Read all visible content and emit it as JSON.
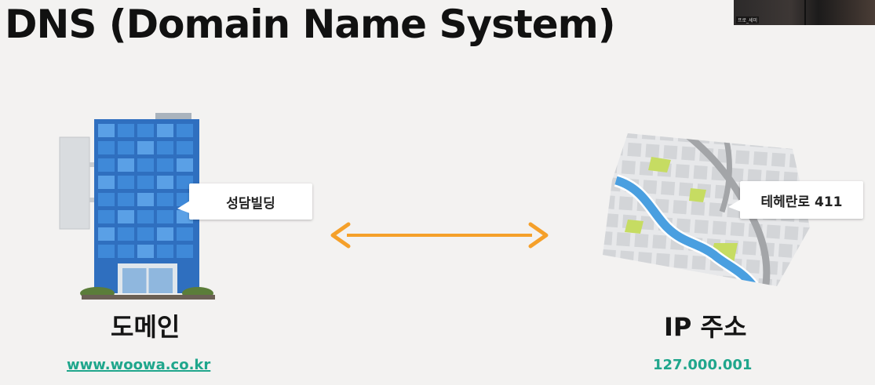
{
  "slide": {
    "title": "DNS (Domain Name System)"
  },
  "webcam": {
    "label": "프로_세미"
  },
  "domain_side": {
    "callout": "성담빌딩",
    "caption": "도메인",
    "example": "www.woowa.co.kr"
  },
  "ip_side": {
    "callout": "테헤란로 411",
    "caption": "IP 주소",
    "example": "127.000.001"
  },
  "colors": {
    "arrow": "#f5a02a",
    "accent_text": "#1fa68c",
    "building_glass": "#3a86d6",
    "map_river": "#4a9fe0",
    "map_park": "#c6dc62"
  }
}
